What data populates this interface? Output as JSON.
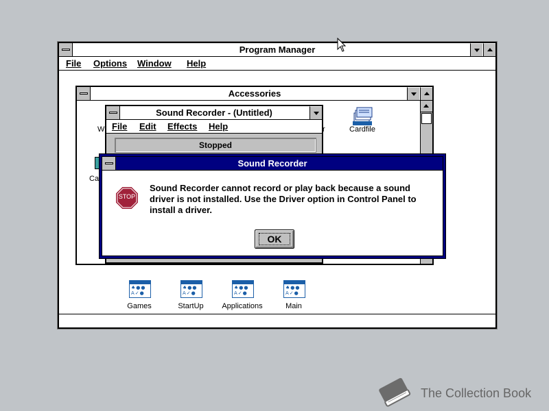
{
  "program_manager": {
    "title": "Program Manager",
    "menu": [
      "File",
      "Options",
      "Window",
      "Help"
    ],
    "group_icons": [
      {
        "label": "Games"
      },
      {
        "label": "StartUp"
      },
      {
        "label": "Applications"
      },
      {
        "label": "Main"
      }
    ]
  },
  "accessories": {
    "title": "Accessories",
    "visible_icon_labels": [
      "Cardfile",
      "r",
      "W",
      "Ca"
    ]
  },
  "sound_recorder": {
    "title": "Sound Recorder - (Untitled)",
    "menu": [
      "File",
      "Edit",
      "Effects",
      "Help"
    ],
    "status": "Stopped"
  },
  "dialog": {
    "title": "Sound Recorder",
    "stop_label": "STOP",
    "message": "Sound Recorder cannot record or play back because a sound driver is not installed. Use the Driver option in Control Panel to install a driver.",
    "ok_label": "OK"
  },
  "watermark": {
    "text": "The Collection Book"
  },
  "colors": {
    "desktop": "#c0c4c8",
    "active_title": "#000080",
    "stop_sign": "#a0213a"
  }
}
